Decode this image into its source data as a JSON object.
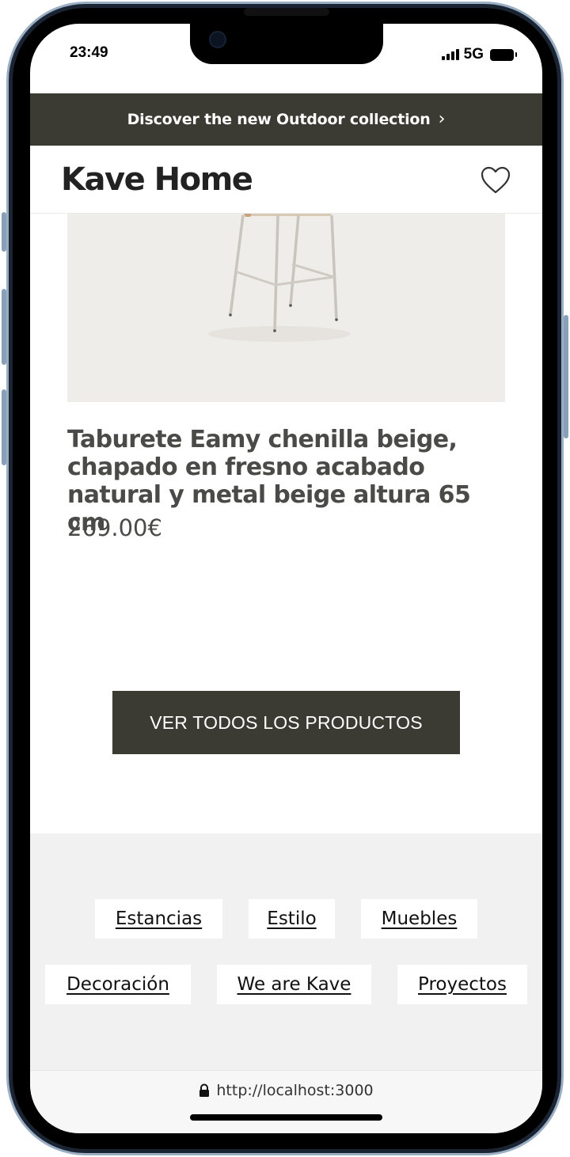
{
  "status_bar": {
    "time": "23:49",
    "network": "5G"
  },
  "promo": {
    "text": "Discover the new Outdoor collection",
    "chevron": "›"
  },
  "header": {
    "logo": "Kave Home",
    "wishlist_icon": "heart-icon"
  },
  "product": {
    "title": "Taburete Eamy chenilla beige, chapado en fresno acabado natural y metal beige altura 65 cm",
    "price": "269.00€"
  },
  "cta": {
    "label": "VER TODOS LOS PRODUCTOS"
  },
  "footer": {
    "links": [
      "Estancias",
      "Estilo",
      "Muebles",
      "Decoración",
      "We are Kave",
      "Proyectos"
    ]
  },
  "browser": {
    "url": "http://localhost:3000",
    "lock_icon": "lock-icon"
  },
  "colors": {
    "banner": "#3b3a33",
    "footer_bg": "#f1f1f1",
    "product_bg": "#efede9"
  }
}
